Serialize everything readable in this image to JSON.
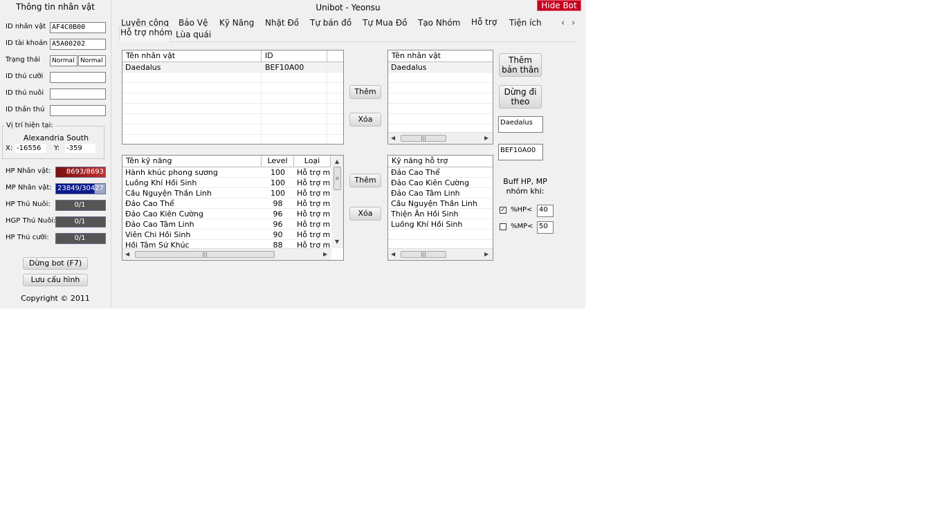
{
  "window": {
    "title": "Unibot - Yeonsu",
    "hide_bot_label": "Hide Bot"
  },
  "left": {
    "header": "Thông tin nhân vật",
    "fields": [
      {
        "label": "ID nhân vật",
        "value": "AF4C0B00"
      },
      {
        "label": "ID tài khoản",
        "value": "A5A00202"
      },
      {
        "label": "Trạng thái",
        "value1": "Normal",
        "value2": "Normal"
      },
      {
        "label": "ID thú cưỡi",
        "value": ""
      },
      {
        "label": "ID thú nuôi",
        "value": ""
      },
      {
        "label": "ID thần thú",
        "value": ""
      }
    ],
    "location": {
      "group_label": "Vị trí hiện tại:",
      "place": "Alexandria South",
      "x_label": "X:",
      "x": "-16556",
      "y_label": "Y:",
      "y": "-359"
    },
    "bars": [
      {
        "label": "HP Nhân vật:",
        "text": "8693/8693",
        "fill": 1.0,
        "color": "#8b1a1a"
      },
      {
        "label": "MP Nhân vật:",
        "text": "23849/30427",
        "fill": 0.78,
        "color": "#0a1a8c"
      },
      {
        "label": "HP Thú Nuôi:",
        "text": "0/1",
        "fill": 0,
        "color": "#555555"
      },
      {
        "label": "HGP Thú Nuôi:",
        "text": "0/1",
        "fill": 0,
        "color": "#555555"
      },
      {
        "label": "HP Thú cưỡi:",
        "text": "0/1",
        "fill": 0,
        "color": "#555555"
      }
    ],
    "stop_button": "Dừng bot (F7)",
    "save_button": "Lưu cấu hình",
    "copyright": "Copyright © 2011"
  },
  "tabs": {
    "row1": [
      "Luyện công",
      "Bảo Vệ",
      "Kỹ Năng",
      "Nhặt Đồ",
      "Tự bán đồ",
      "Tự Mua Đồ",
      "Tạo Nhóm",
      "Hỗ trợ",
      "Tiện ích"
    ],
    "row2": [
      "Hỗ trợ nhóm",
      "Lùa quái"
    ],
    "selected": "Hỗ trợ nhóm"
  },
  "party": {
    "list_headers": [
      "Tên nhân vật",
      "ID"
    ],
    "list_rows": [
      {
        "name": "Daedalus",
        "id": "BEF10A00"
      }
    ],
    "add_label": "Thêm",
    "remove_label": "Xóa",
    "selected_header": "Tên nhân vật",
    "selected_rows": [
      "Daedalus"
    ],
    "add_self_label": "Thêm bản thân",
    "follow_label": "Dừng đi theo",
    "name_field": "Daedalus",
    "id_field": "BEF10A00"
  },
  "skills": {
    "headers": [
      "Tên kỹ năng",
      "Level",
      "Loại"
    ],
    "rows": [
      {
        "name": "Hành khúc phong sương",
        "level": "100",
        "type": "Hỗ trợ m"
      },
      {
        "name": "Luồng Khí Hồi Sinh",
        "level": "100",
        "type": "Hỗ trợ m"
      },
      {
        "name": "Cầu Nguyện Thần Linh",
        "level": "100",
        "type": "Hỗ trợ m"
      },
      {
        "name": "Đảo Cao Thể",
        "level": "98",
        "type": "Hỗ trợ m"
      },
      {
        "name": "Đảo Cao Kiên Cường",
        "level": "96",
        "type": "Hỗ trợ m"
      },
      {
        "name": "Đảo Cao Tâm Linh",
        "level": "96",
        "type": "Hỗ trợ m"
      },
      {
        "name": "Viên Chi Hồi Sinh",
        "level": "90",
        "type": "Hỗ trợ m"
      },
      {
        "name": "Hồi Tâm Sứ Khúc",
        "level": "88",
        "type": "Hỗ trợ m"
      }
    ],
    "add_label": "Thêm",
    "remove_label": "Xóa",
    "support_header": "Kỹ năng hỗ trợ",
    "support_rows": [
      "Đảo Cao Thể",
      "Đảo Cao Kiên Cường",
      "Đảo Cao Tâm Linh",
      "Cầu Nguyện Thần Linh",
      "Thiện Ân Hồi Sinh",
      "Luồng Khí Hồi Sinh"
    ]
  },
  "buff": {
    "title": "Buff HP, MP nhóm khi:",
    "hp_label": "%HP<",
    "hp_checked": true,
    "hp_value": "40",
    "mp_label": "%MP<",
    "mp_checked": false,
    "mp_value": "50"
  }
}
